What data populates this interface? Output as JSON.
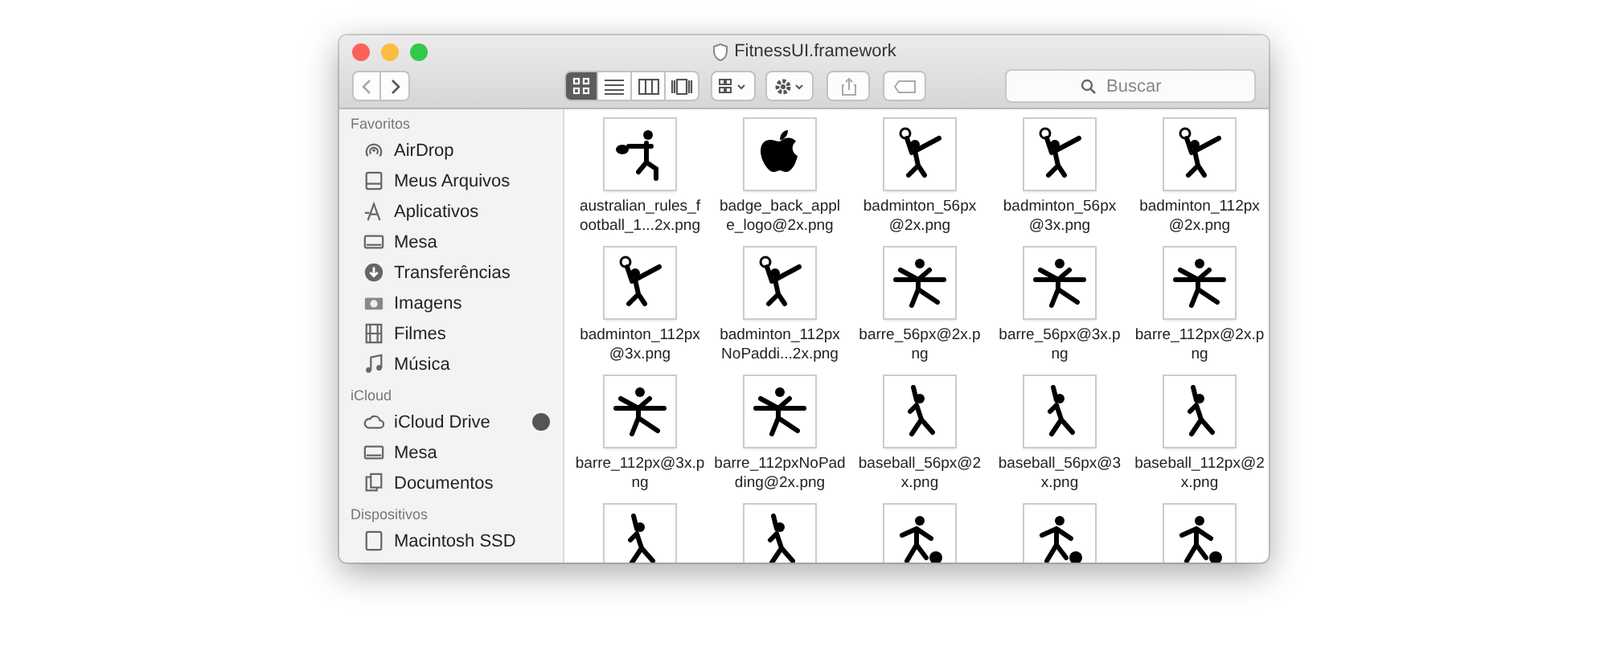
{
  "window": {
    "title": "FitnessUI.framework"
  },
  "toolbar": {
    "views": [
      {
        "kind": "icons",
        "selected": true
      },
      {
        "kind": "list",
        "selected": false
      },
      {
        "kind": "columns",
        "selected": false
      },
      {
        "kind": "cover",
        "selected": false
      }
    ],
    "search": {
      "placeholder": "Buscar"
    }
  },
  "sidebar": [
    {
      "heading": "Favoritos",
      "items": [
        {
          "label": "AirDrop",
          "kind": "airdrop"
        },
        {
          "label": "Meus Arquivos",
          "kind": "files"
        },
        {
          "label": "Aplicativos",
          "kind": "apps"
        },
        {
          "label": "Mesa",
          "kind": "desktop"
        },
        {
          "label": "Transferências",
          "kind": "download"
        },
        {
          "label": "Imagens",
          "kind": "camera"
        },
        {
          "label": "Filmes",
          "kind": "film"
        },
        {
          "label": "Música",
          "kind": "music"
        }
      ]
    },
    {
      "heading": "iCloud",
      "items": [
        {
          "label": "iCloud Drive",
          "kind": "cloud",
          "syncing": true
        },
        {
          "label": "Mesa",
          "kind": "desktop"
        },
        {
          "label": "Documentos",
          "kind": "docs"
        }
      ]
    },
    {
      "heading": "Dispositivos",
      "items": [
        {
          "label": "Macintosh SSD",
          "kind": "disk"
        }
      ]
    }
  ],
  "files": [
    {
      "kind": "football",
      "name_lines": [
        "australian_rules_f",
        "ootball_1...2x.png"
      ]
    },
    {
      "kind": "apple",
      "name_lines": [
        "badge_back_appl",
        "e_logo@2x.png"
      ]
    },
    {
      "kind": "badminton",
      "name_lines": [
        "badminton_56px",
        "@2x.png"
      ]
    },
    {
      "kind": "badminton",
      "name_lines": [
        "badminton_56px",
        "@3x.png"
      ]
    },
    {
      "kind": "badminton",
      "name_lines": [
        "badminton_112px",
        "@2x.png"
      ]
    },
    {
      "kind": "badminton",
      "name_lines": [
        "badminton_112px",
        "@3x.png"
      ]
    },
    {
      "kind": "badminton",
      "name_lines": [
        "badminton_112px",
        "NoPaddi...2x.png"
      ]
    },
    {
      "kind": "barre",
      "name_lines": [
        "barre_56px@2x.p",
        "ng"
      ]
    },
    {
      "kind": "barre",
      "name_lines": [
        "barre_56px@3x.p",
        "ng"
      ]
    },
    {
      "kind": "barre",
      "name_lines": [
        "barre_112px@2x.p",
        "ng"
      ]
    },
    {
      "kind": "barre",
      "name_lines": [
        "barre_112px@3x.p",
        "ng"
      ]
    },
    {
      "kind": "barre",
      "name_lines": [
        "barre_112pxNoPad",
        "ding@2x.png"
      ]
    },
    {
      "kind": "baseball",
      "name_lines": [
        "baseball_56px@2",
        "x.png"
      ]
    },
    {
      "kind": "baseball",
      "name_lines": [
        "baseball_56px@3",
        "x.png"
      ]
    },
    {
      "kind": "baseball",
      "name_lines": [
        "baseball_112px@2",
        "x.png"
      ]
    },
    {
      "kind": "baseball"
    },
    {
      "kind": "baseball"
    },
    {
      "kind": "basketball"
    },
    {
      "kind": "basketball"
    },
    {
      "kind": "basketball"
    }
  ]
}
